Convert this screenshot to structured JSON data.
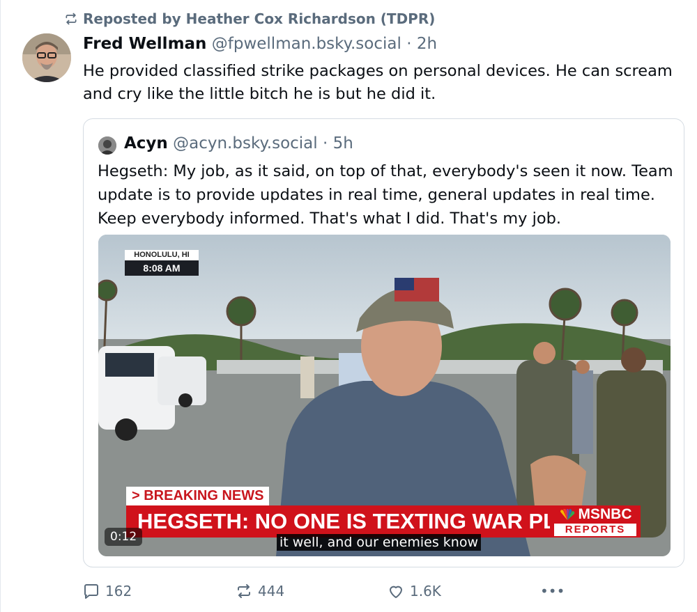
{
  "repost_label": "Reposted by Heather Cox Richardson (TDPR)",
  "post": {
    "author_name": "Fred Wellman",
    "author_handle": "@fpwellman.bsky.social",
    "time": "2h",
    "text": "He provided classified strike packages on personal devices. He can scream and cry like the little bitch he is but he did it."
  },
  "quote": {
    "author_name": "Acyn",
    "author_handle": "@acyn.bsky.social",
    "time": "5h",
    "text": "Hegseth: My job, as it said, on top of that, everybody's seen it now. Team update is to provide updates in real time, general updates in real time. Keep everybody informed. That's what I did. That's my job.",
    "video": {
      "dateline_place": "HONOLULU, HI",
      "dateline_time": "8:08 AM",
      "breaking_tag": "> BREAKING NEWS",
      "headline": "HEGSETH: NO ONE IS TEXTING WAR PLANS",
      "network": "MSNBC",
      "network_sub": "REPORTS",
      "caption": "it well, and our enemies know",
      "timestamp": "0:12"
    }
  },
  "actions": {
    "replies": "162",
    "reposts": "444",
    "likes": "1.6K",
    "more": "•••"
  },
  "colors": {
    "muted": "#5a6b7c",
    "border": "#d4dbe2",
    "breaking_red": "#d0121b"
  }
}
